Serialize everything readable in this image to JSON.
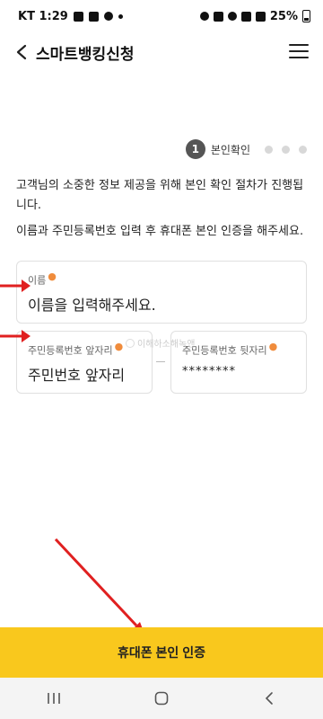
{
  "status_bar": {
    "carrier_time": "KT 1:29",
    "battery_percent": "25%"
  },
  "header": {
    "title": "스마트뱅킹신청"
  },
  "steps": {
    "current_number": "1",
    "current_label": "본인확인",
    "total_dots": 3
  },
  "description": {
    "line1": "고객님의 소중한 정보 제공을 위해 본인 확인 절차가 진행됩니다.",
    "line2": "이름과 주민등록번호 입력 후 휴대폰 본인 인증을 해주세요."
  },
  "form": {
    "name": {
      "label": "이름",
      "placeholder": "이름을 입력해주세요."
    },
    "rrn_front": {
      "label": "주민등록번호 앞자리",
      "placeholder": "주민번호 앞자리"
    },
    "rrn_back": {
      "label": "주민등록번호 뒷자리",
      "placeholder": "********"
    }
  },
  "watermark": {
    "text": "이해하소해녹앤"
  },
  "footer": {
    "verify_button_label": "휴대폰 본인 인증"
  },
  "icons": {
    "back": "chevron-left-icon",
    "menu": "hamburger-menu-icon",
    "arrow_color": "#e02020"
  },
  "colors": {
    "accent": "#f9c81d",
    "required_marker": "#f08c3c",
    "step_active": "#555555"
  }
}
